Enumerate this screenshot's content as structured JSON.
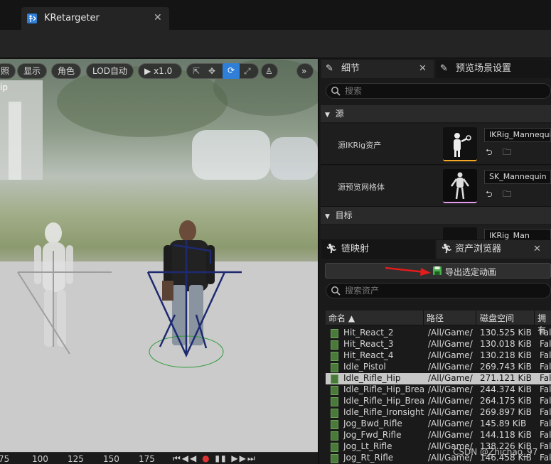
{
  "window": {
    "tab_title": "KRetargeter"
  },
  "viewport": {
    "toolbar": {
      "lighting_partial": "照",
      "show": "显示",
      "character": "角色",
      "lod": "LOD自动",
      "speed": "x1.0"
    },
    "overlay_partial": "ip"
  },
  "timeline": {
    "ticks": [
      "75",
      "100",
      "125",
      "150",
      "175"
    ]
  },
  "details_panel": {
    "tab_details": "细节",
    "tab_preview_settings": "预览场景设置",
    "search_placeholder": "搜索",
    "section_source": "源",
    "source_ikrig_label": "源IKRig资产",
    "source_ikrig_value": "IKRig_Mannequin",
    "source_mesh_label": "源预览网格体",
    "source_mesh_value": "SK_Mannequin",
    "section_target": "目标",
    "target_ikrig_value_partial": "IKRig_Man"
  },
  "bottom_panel": {
    "tab_chain_mapping": "链映射",
    "tab_asset_browser": "资产浏览器",
    "export_button": "导出选定动画",
    "search_placeholder": "搜索资产",
    "columns": [
      "命名 ▲",
      "路径",
      "磁盘空间",
      "拥有"
    ],
    "rows": [
      {
        "name": "Hit_React_2",
        "path": "/All/Game/",
        "size": "130.525 KiB",
        "owner": "Fal",
        "selected": false
      },
      {
        "name": "Hit_React_3",
        "path": "/All/Game/",
        "size": "130.018 KiB",
        "owner": "Fal",
        "selected": false
      },
      {
        "name": "Hit_React_4",
        "path": "/All/Game/",
        "size": "130.218 KiB",
        "owner": "Fal",
        "selected": false
      },
      {
        "name": "Idle_Pistol",
        "path": "/All/Game/",
        "size": "269.743 KiB",
        "owner": "Fal",
        "selected": false
      },
      {
        "name": "Idle_Rifle_Hip",
        "path": "/All/Game/",
        "size": "271.121 KiB",
        "owner": "Fal",
        "selected": true
      },
      {
        "name": "Idle_Rifle_Hip_Break",
        "path": "/All/Game/",
        "size": "244.374 KiB",
        "owner": "Fal",
        "selected": false
      },
      {
        "name": "Idle_Rifle_Hip_Break",
        "path": "/All/Game/",
        "size": "264.175 KiB",
        "owner": "Fal",
        "selected": false
      },
      {
        "name": "Idle_Rifle_Ironsights",
        "path": "/All/Game/",
        "size": "269.897 KiB",
        "owner": "Fal",
        "selected": false
      },
      {
        "name": "Jog_Bwd_Rifle",
        "path": "/All/Game/",
        "size": "145.89 KiB",
        "owner": "Fal",
        "selected": false
      },
      {
        "name": "Jog_Fwd_Rifle",
        "path": "/All/Game/",
        "size": "144.118 KiB",
        "owner": "Fal",
        "selected": false
      },
      {
        "name": "Jog_Lt_Rifle",
        "path": "/All/Game/",
        "size": "138.226 KiB",
        "owner": "Fal",
        "selected": false
      },
      {
        "name": "Jog_Rt_Rifle",
        "path": "/All/Game/",
        "size": "146.458 KiB",
        "owner": "Fal",
        "selected": false
      }
    ]
  },
  "watermark": "CSDN @Zhichao_97",
  "colors": {
    "accent_blue": "#2f7fd8",
    "selected_row": "#c8c8c8",
    "thumb_underline_source": "#f5a623",
    "thumb_underline_mesh": "#e59cf0"
  },
  "icons": [
    "retargeter-icon",
    "close-icon",
    "play-icon",
    "select-icon",
    "move-icon",
    "rotate-icon",
    "scale-icon",
    "mannequin-icon",
    "chevron-right-icon",
    "pen-icon",
    "search-icon",
    "running-man-icon",
    "save-icon",
    "arrow-back-icon",
    "browse-folder-icon",
    "anim-sequence-icon"
  ]
}
